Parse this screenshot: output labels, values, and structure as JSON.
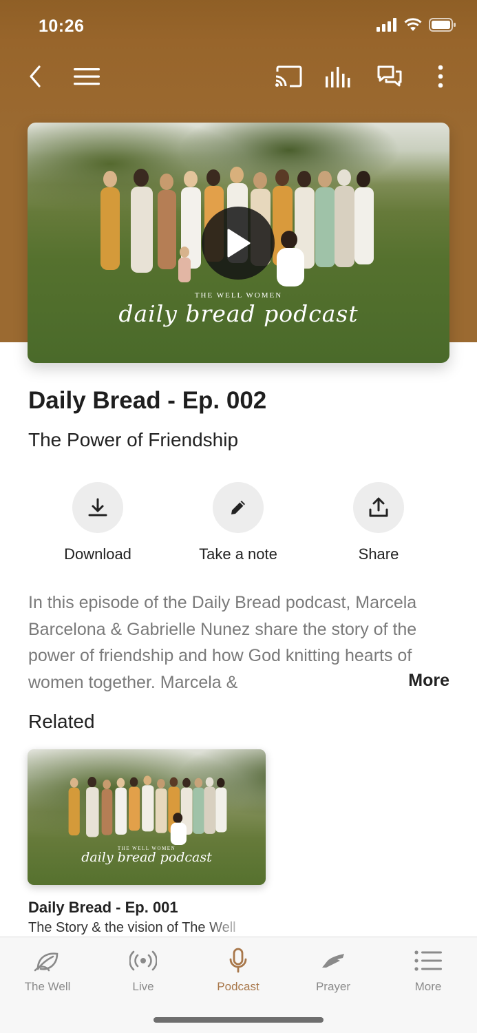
{
  "status": {
    "time": "10:26",
    "icons": [
      "signal-icon",
      "wifi-icon",
      "battery-icon"
    ]
  },
  "toolbar": {
    "icons": [
      "back-icon",
      "menu-icon",
      "cast-icon",
      "equalizer-icon",
      "chat-icon",
      "more-vertical-icon"
    ]
  },
  "colors": {
    "header": "#9b6a31",
    "accent": "#a8774a",
    "tab_inactive": "#8a8a8a",
    "action_circle": "#ededed"
  },
  "hero": {
    "brand": "THE WELL WOMEN",
    "script": "daily bread podcast",
    "play_icon": "play-icon"
  },
  "episode": {
    "title": "Daily Bread - Ep. 002",
    "subtitle": "The Power of Friendship"
  },
  "actions": [
    {
      "label": "Download",
      "icon": "download-icon"
    },
    {
      "label": "Take a note",
      "icon": "pencil-icon"
    },
    {
      "label": "Share",
      "icon": "share-icon"
    }
  ],
  "description": {
    "text": "In this episode of the Daily Bread podcast, Marcela Barcelona & Gabrielle Nunez share the story of the power of friendship and how God knitting hearts of women together. Marcela &",
    "more_label": "More"
  },
  "related": {
    "title": "Related",
    "items": [
      {
        "brand": "THE WELL WOMEN",
        "script": "daily bread podcast",
        "title": "Daily Bread - Ep. 001",
        "subtitle": "The Story & the vision of The Well"
      }
    ]
  },
  "tabbar": {
    "tabs": [
      {
        "label": "The Well",
        "icon": "leaf-icon",
        "active": false
      },
      {
        "label": "Live",
        "icon": "broadcast-icon",
        "active": false
      },
      {
        "label": "Podcast",
        "icon": "microphone-icon",
        "active": true
      },
      {
        "label": "Prayer",
        "icon": "praying-hands-icon",
        "active": false
      },
      {
        "label": "More",
        "icon": "list-icon",
        "active": false
      }
    ]
  }
}
